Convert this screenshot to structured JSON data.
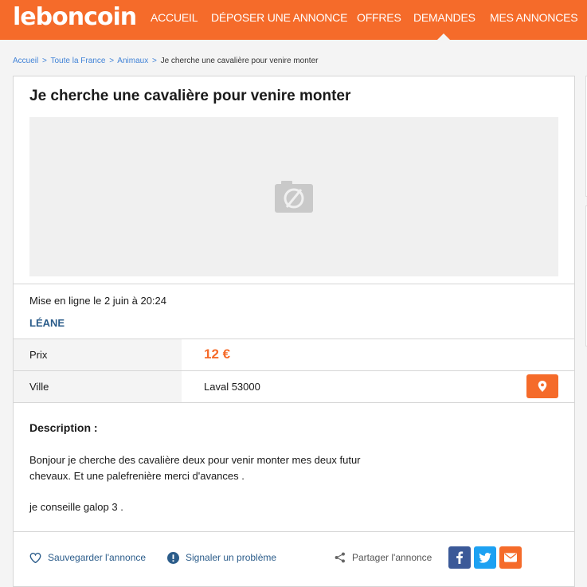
{
  "header": {
    "logo": "leboncoin",
    "nav": [
      "ACCUEIL",
      "DÉPOSER UNE ANNONCE",
      "OFFRES",
      "DEMANDES",
      "MES ANNONCES"
    ],
    "active_nav": "DEMANDES",
    "brand_color": "#f56b2a"
  },
  "breadcrumb": {
    "items": [
      "Accueil",
      "Toute la France",
      "Animaux"
    ],
    "current": "Je cherche une cavalière pour venire monter",
    "separator": ">"
  },
  "ad": {
    "title": "Je cherche une cavalière pour venire monter",
    "photo_icon": "no-photo-icon",
    "posted": "Mise en ligne le 2 juin à 20:24",
    "user": "LÉANE",
    "price_label": "Prix",
    "price": "12 €",
    "city_label": "Ville",
    "city": "Laval 53000",
    "map_icon": "map-pin-icon",
    "description_title": "Description :",
    "description_p1_line1": "Bonjour je cherche des cavalière deux pour venir monter mes deux futur",
    "description_p1_line2": "chevaux. Et une palefrenière merci d'avances .",
    "description_p2": "je conseille galop 3 ."
  },
  "actions": {
    "save": "Sauvegarder l'annonce",
    "report": "Signaler un problème",
    "share": "Partager l'annonce",
    "facebook_icon": "facebook-icon",
    "twitter_icon": "twitter-icon",
    "email_icon": "email-icon"
  }
}
